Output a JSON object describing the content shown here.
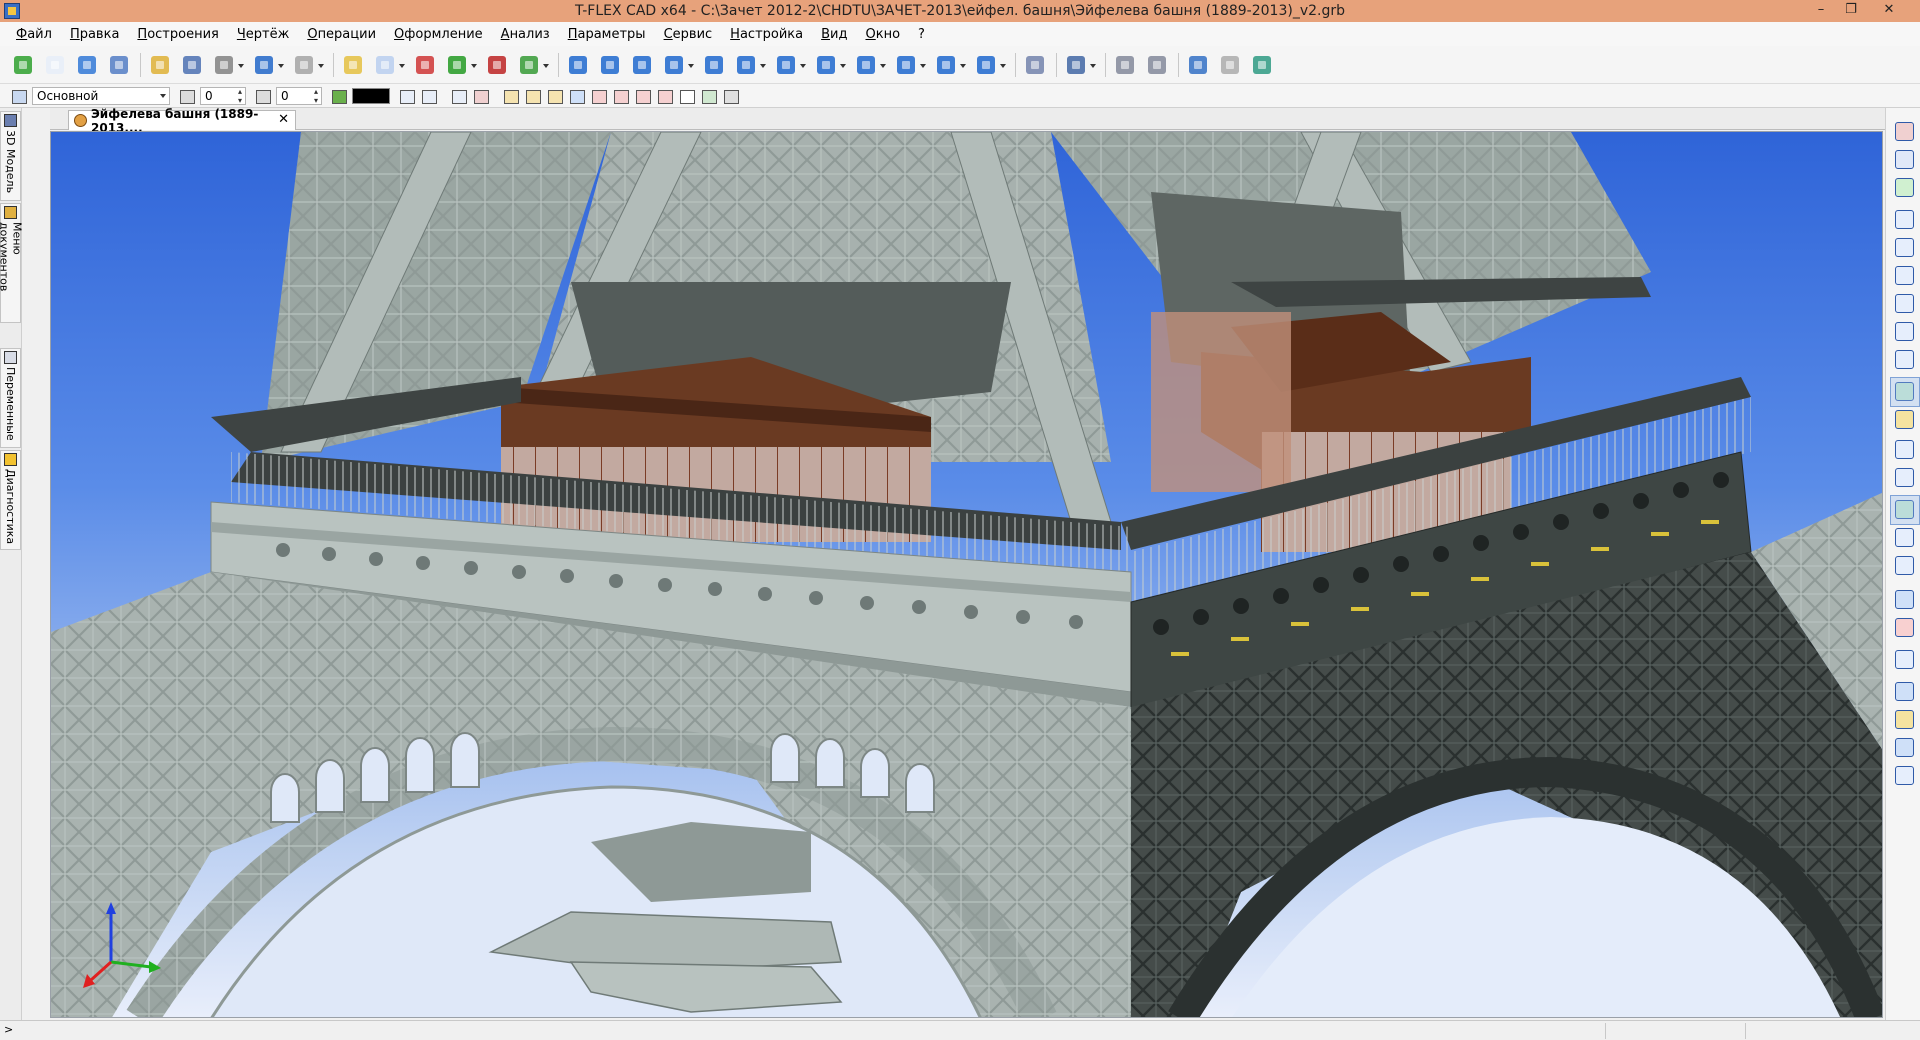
{
  "window": {
    "title": "T-FLEX CAD x64 - C:\\Зачет 2012-2\\CHDTU\\ЗАЧЕТ-2013\\ейфел. башня\\Эйфелева башня (1889-2013)_v2.grb",
    "minimize": "–",
    "restore": "❐",
    "close": "✕"
  },
  "menu": {
    "items": [
      "Файл",
      "Правка",
      "Построения",
      "Чертёж",
      "Операции",
      "Оформление",
      "Анализ",
      "Параметры",
      "Сервис",
      "Настройка",
      "Вид",
      "Окно",
      "?"
    ]
  },
  "toolbar2": {
    "layer": "Основной",
    "field1": "0",
    "field2": "0"
  },
  "side_tabs": [
    "3D Модель",
    "Меню документов",
    "Переменные",
    "Диагностика"
  ],
  "document_tab": {
    "label": "Эйфелева башня (1889-2013....",
    "close": "✕"
  },
  "colors": {
    "titlebar": "#e7a27b",
    "sky_top": "#2f64d8",
    "sky_bottom": "#e8eefb",
    "steel_light": "#aab4b0",
    "steel_dark": "#3d4442",
    "roof_brown": "#5a3220"
  },
  "axes_triad": {
    "x_color": "#e02020",
    "y_color": "#20b020",
    "z_color": "#2040e0"
  },
  "status": {
    "arrow": ">"
  }
}
